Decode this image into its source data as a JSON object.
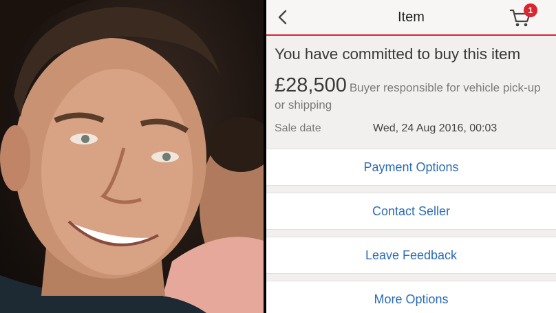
{
  "header": {
    "title": "Item",
    "back_icon": "chevron-left-icon",
    "cart_icon": "cart-icon",
    "cart_count": "1",
    "accent_color": "#d9262f"
  },
  "purchase": {
    "headline": "You have committed to buy this item",
    "price": "£28,500",
    "price_note": "Buyer responsible for vehicle pick-up or shipping",
    "sale_date_label": "Sale date",
    "sale_date_value": "Wed, 24 Aug 2016, 00:03"
  },
  "actions": [
    {
      "label": "Payment Options"
    },
    {
      "label": "Contact Seller"
    },
    {
      "label": "Leave Feedback"
    },
    {
      "label": "More Options"
    }
  ],
  "link_color": "#2b6cb6"
}
